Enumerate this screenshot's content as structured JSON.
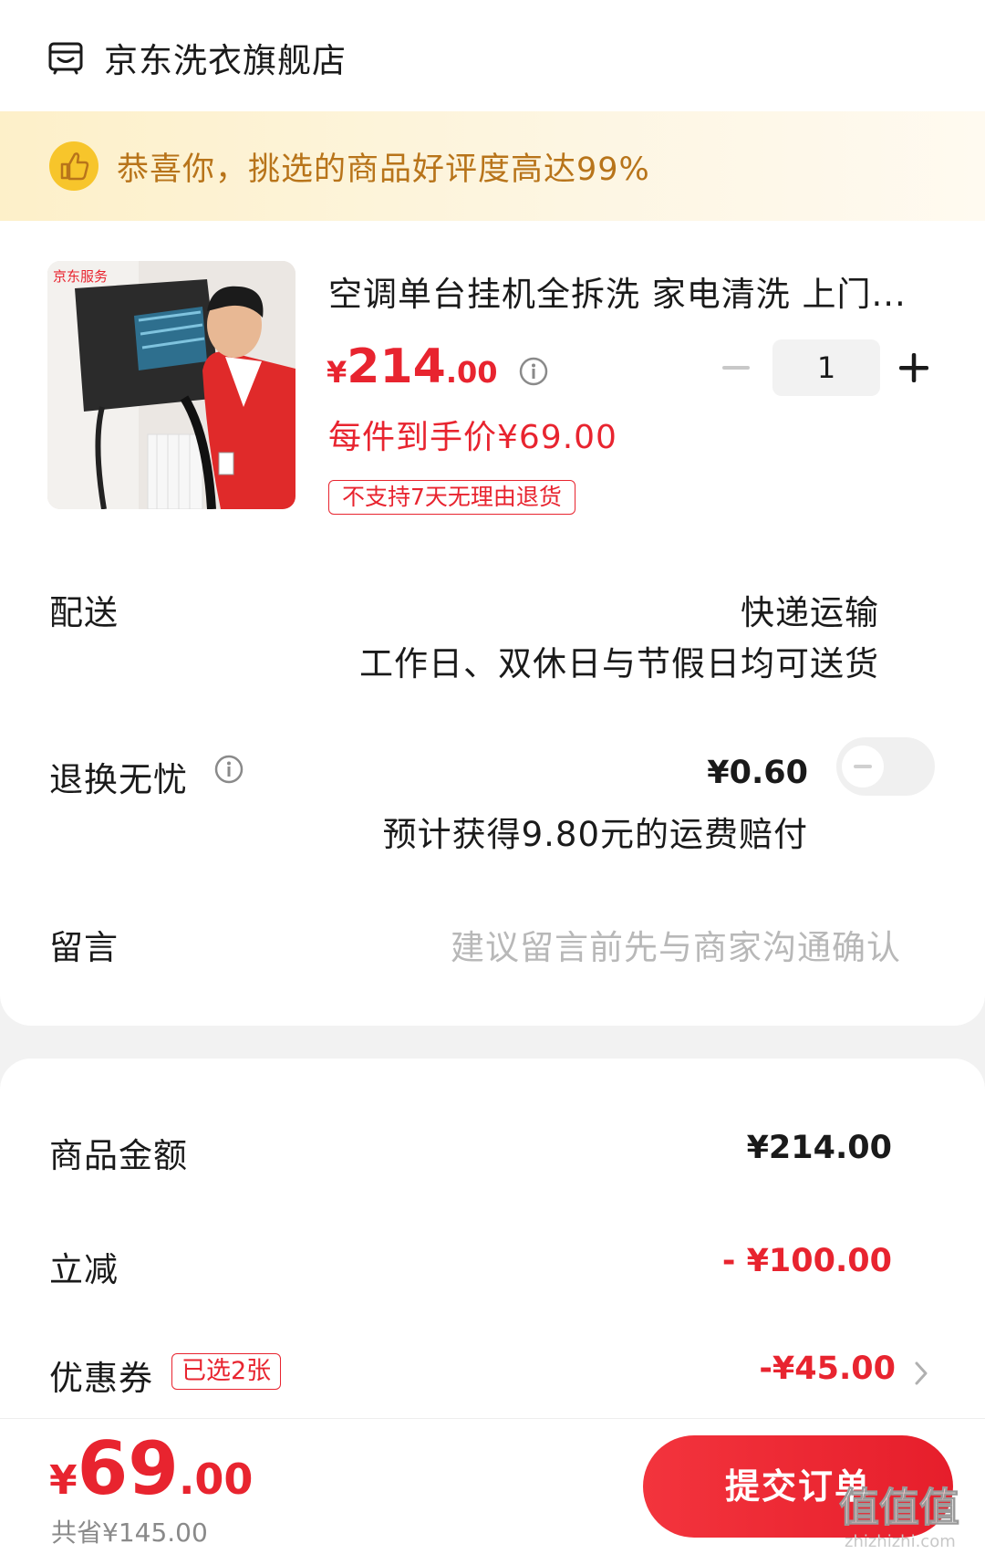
{
  "store": {
    "name": "京东洗衣旗舰店"
  },
  "banner": {
    "text": "恭喜你，挑选的商品好评度高达99%"
  },
  "product": {
    "image_brand_text": "京东服务",
    "title": "空调单台挂机全拆洗 家电清洗 上门...",
    "price_yen": "¥",
    "price_int": "214",
    "price_dec": ".00",
    "hand_price": "每件到手价¥69.00",
    "no_return_tag": "不支持7天无理由退货",
    "quantity": "1"
  },
  "delivery": {
    "label": "配送",
    "method": "快递运输",
    "note": "工作日、双休日与节假日均可送货"
  },
  "worry_free_return": {
    "label": "退换无忧",
    "price": "¥0.60",
    "note": "预计获得9.80元的运费赔付",
    "enabled": false
  },
  "remark": {
    "label": "留言",
    "placeholder": "建议留言前先与商家沟通确认"
  },
  "summary": {
    "goods_amount_label": "商品金额",
    "goods_amount_value": "¥214.00",
    "instant_discount_label": "立减",
    "instant_discount_value": "- ¥100.00",
    "coupon_label": "优惠券",
    "coupon_tag": "已选2张",
    "coupon_value": "-¥45.00"
  },
  "footer": {
    "total_yen": "¥",
    "total_int": "69",
    "total_dec": ".00",
    "saved": "共省¥145.00",
    "submit_label": "提交订单"
  },
  "watermark": {
    "text": "值值值",
    "url_text": "zhizhizhi.com"
  },
  "colors": {
    "accent_red": "#e8242f",
    "banner_text": "#b8741a",
    "banner_bg": "#fdf0c9"
  },
  "icons": [
    "store-icon",
    "thumbs-up-icon",
    "info-icon",
    "minus-icon",
    "plus-icon",
    "chevron-right-icon"
  ]
}
